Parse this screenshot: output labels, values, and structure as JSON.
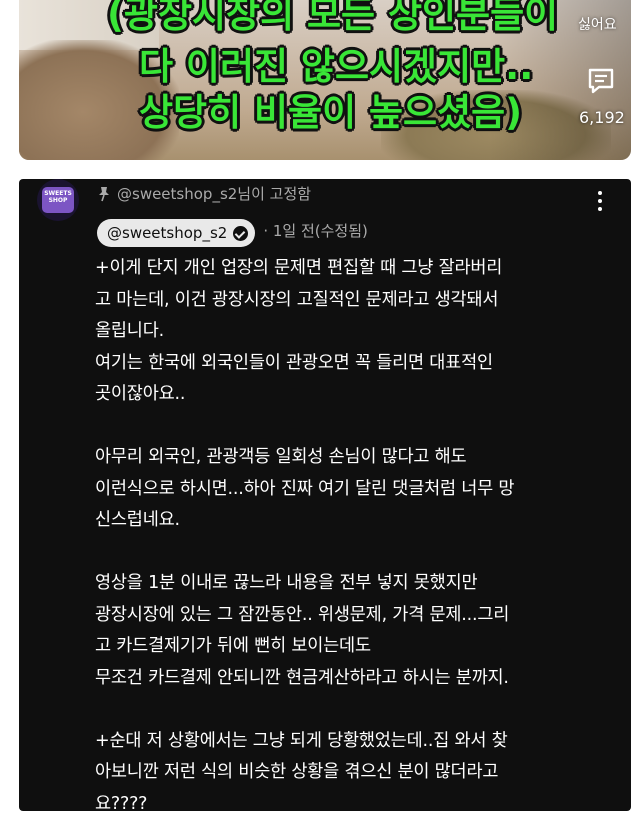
{
  "video": {
    "caption_lines": [
      "(광장시장의 모든 상인분들이",
      "다 이러진 않으시겠지만..",
      "상당히 비율이 높으셨음)"
    ],
    "dislike_label": "싫어요",
    "comment_icon": "comment-icon",
    "comment_count": "6,192"
  },
  "comment": {
    "pinned_text": "@sweetshop_s2님이 고정함",
    "author": "@sweetshop_s2",
    "meta": "· 1일 전(수정됨)",
    "avatar_text": "SWEETS SHOP",
    "body_lines": [
      "+이게 단지 개인 업장의 문제면 편집할 때 그냥 잘라버리",
      "고 마는데, 이건 광장시장의 고질적인 문제라고 생각돼서",
      "올립니다.",
      "여기는 한국에 외국인들이 관광오면 꼭 들리면 대표적인",
      "곳이잖아요..",
      "",
      "아무리 외국인, 관광객등 일회성 손님이 많다고 해도",
      "이런식으로 하시면...하아 진짜 여기 달린 댓글처럼 너무 망",
      "신스럽네요.",
      "",
      "영상을 1분 이내로 끊느라 내용을 전부 넣지 못했지만",
      "광장시장에 있는 그 잠깐동안.. 위생문제, 가격 문제...그리",
      "고 카드결제기가 뒤에 뻔히 보이는데도",
      "무조건 카드결제 안되니깐 현금계산하라고 하시는 분까지.",
      "",
      "+순대 저 상황에서는 그냥 되게 당황했었는데..집 와서 찾",
      "아보니깐 저런 식의 비슷한 상황을 겪으신 분이 많더라고",
      "요????"
    ]
  },
  "colors": {
    "caption_text": "#39e637",
    "card_background": "#0f0f0f",
    "meta_text": "#aaaaaa"
  }
}
